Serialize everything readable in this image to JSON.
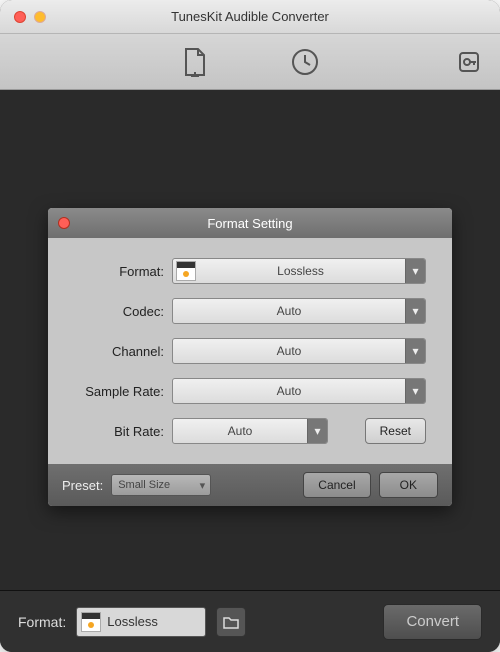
{
  "window": {
    "title": "TunesKit Audible Converter"
  },
  "modal": {
    "title": "Format Setting",
    "rows": {
      "format": {
        "label": "Format:",
        "value": "Lossless"
      },
      "codec": {
        "label": "Codec:",
        "value": "Auto"
      },
      "channel": {
        "label": "Channel:",
        "value": "Auto"
      },
      "sampleRate": {
        "label": "Sample Rate:",
        "value": "Auto"
      },
      "bitRate": {
        "label": "Bit Rate:",
        "value": "Auto"
      }
    },
    "reset": "Reset",
    "preset": {
      "label": "Preset:",
      "value": "Small Size"
    },
    "cancel": "Cancel",
    "ok": "OK"
  },
  "bottom": {
    "label": "Format:",
    "value": "Lossless",
    "convert": "Convert"
  }
}
